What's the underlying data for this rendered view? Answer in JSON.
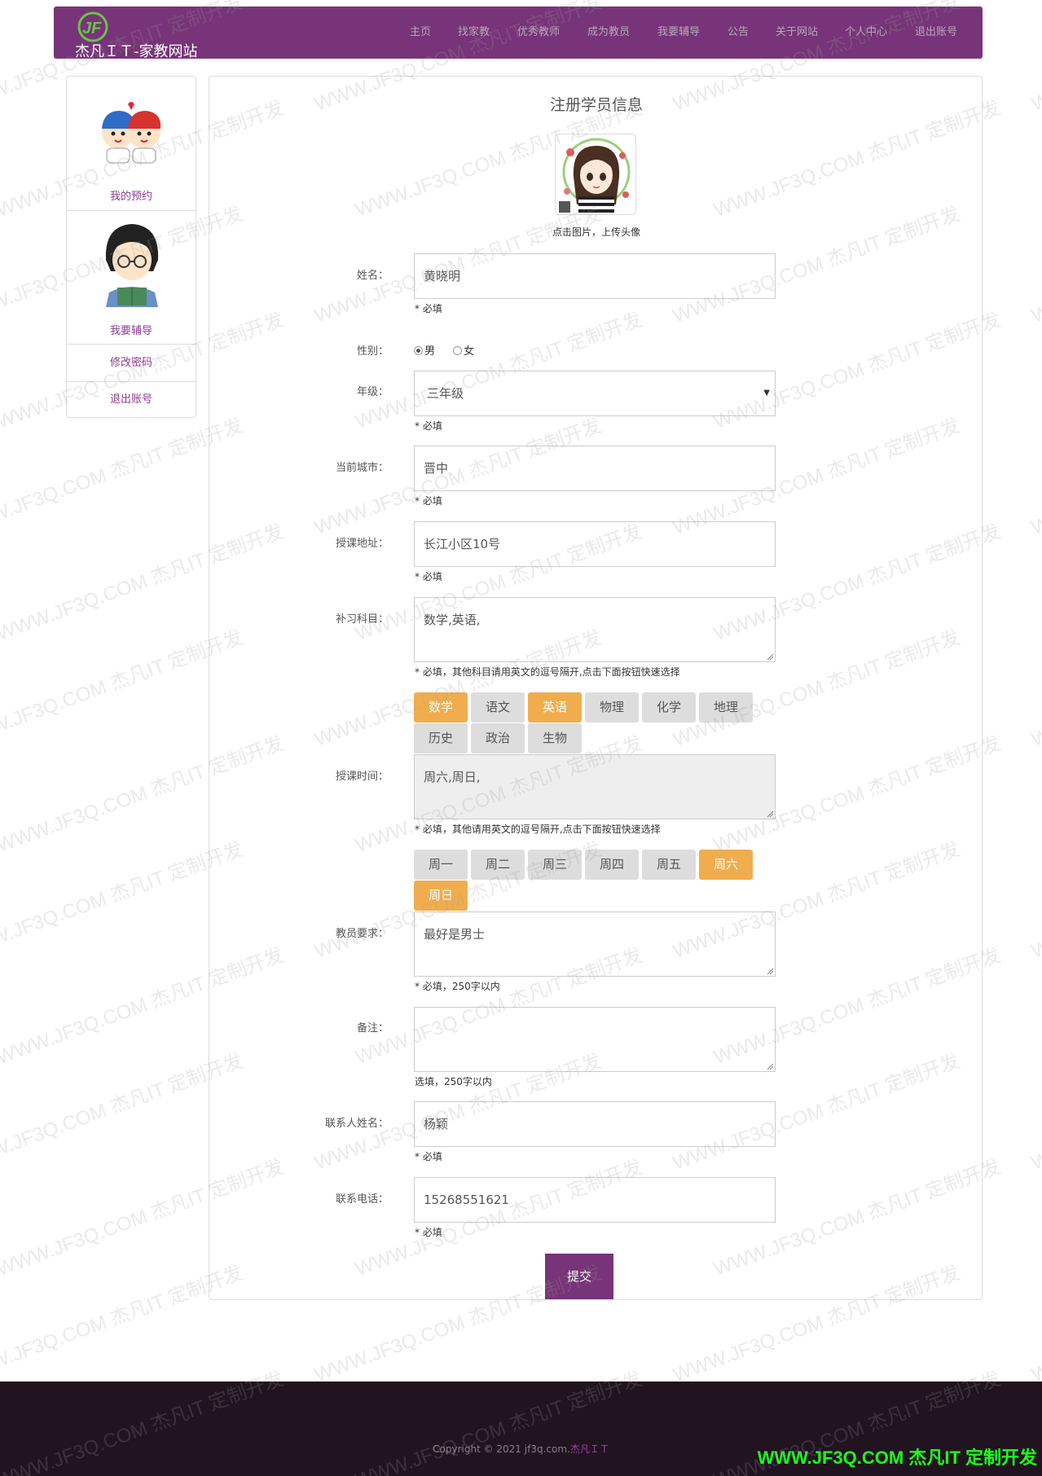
{
  "header": {
    "brand_title": "杰凡ＩＴ-家教网站",
    "nav": [
      "主页",
      "找家教",
      "优秀教师",
      "成为教员",
      "我要辅导",
      "公告",
      "关于网站",
      "个人中心",
      "退出账号"
    ]
  },
  "sidebar": {
    "items": [
      {
        "label": "我的预约"
      },
      {
        "label": "我要辅导"
      },
      {
        "label": "修改密码"
      },
      {
        "label": "退出账号"
      }
    ]
  },
  "form": {
    "title": "注册学员信息",
    "avatar_hint": "点击图片，上传头像",
    "name": {
      "label": "姓名：",
      "value": "黄晓明",
      "hint": "* 必填"
    },
    "gender": {
      "label": "性别：",
      "options": [
        "男",
        "女"
      ],
      "selected": "男"
    },
    "grade": {
      "label": "年级：",
      "value": "三年级",
      "hint": "* 必填"
    },
    "city": {
      "label": "当前城市：",
      "value": "晋中",
      "hint": "* 必填"
    },
    "address": {
      "label": "授课地址：",
      "value": "长江小区10号",
      "hint": "* 必填"
    },
    "subjects": {
      "label": "补习科目：",
      "value": "数学,英语,",
      "hint": "* 必填，其他科目请用英文的逗号隔开,点击下面按钮快速选择",
      "chips": [
        {
          "label": "数学",
          "on": true
        },
        {
          "label": "语文",
          "on": false
        },
        {
          "label": "英语",
          "on": true
        },
        {
          "label": "物理",
          "on": false
        },
        {
          "label": "化学",
          "on": false
        },
        {
          "label": "地理",
          "on": false
        },
        {
          "label": "历史",
          "on": false
        },
        {
          "label": "政治",
          "on": false
        },
        {
          "label": "生物",
          "on": false
        }
      ]
    },
    "times": {
      "label": "授课时间：",
      "value": "周六,周日,",
      "hint": "* 必填，其他请用英文的逗号隔开,点击下面按钮快速选择",
      "chips": [
        {
          "label": "周一",
          "on": false
        },
        {
          "label": "周二",
          "on": false
        },
        {
          "label": "周三",
          "on": false
        },
        {
          "label": "周四",
          "on": false
        },
        {
          "label": "周五",
          "on": false
        },
        {
          "label": "周六",
          "on": true
        },
        {
          "label": "周日",
          "on": true
        }
      ]
    },
    "teacher_req": {
      "label": "教员要求：",
      "value": "最好是男士",
      "hint": "* 必填，250字以内"
    },
    "remark": {
      "label": "备注：",
      "value": "",
      "hint": "选填，250字以内"
    },
    "contact_name": {
      "label": "联系人姓名：",
      "value": "杨颖",
      "hint": "* 必填"
    },
    "phone": {
      "label": "联系电话：",
      "value": "15268551621",
      "hint": "* 必填"
    },
    "submit_label": "提交"
  },
  "footer": {
    "copyright_prefix": "Copyright © 2021 jf3q.com.",
    "copyright_accent": "杰凡ＩＴ",
    "corner_mark": "WWW.JF3Q.COM 杰凡IT  定制开发"
  },
  "watermark_text": "WWW.JF3Q.COM 杰凡IT  定制开发",
  "colors": {
    "primary": "#773478",
    "chip_active": "#f0ad4e",
    "chip_inactive": "#dddddd",
    "footer_bg": "#21131f",
    "corner_mark": "#1aff1a"
  }
}
